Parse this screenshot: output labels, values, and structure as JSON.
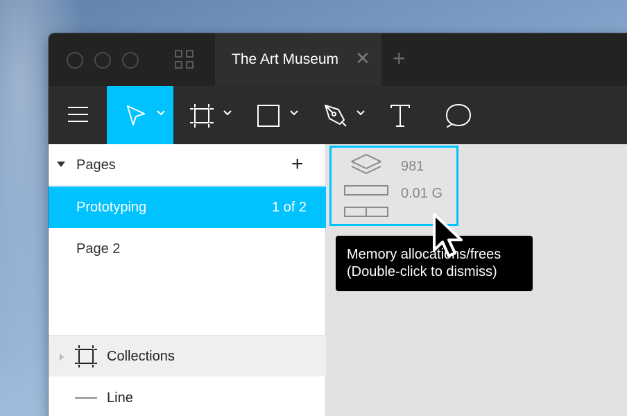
{
  "window": {
    "tab_title": "The Art Museum",
    "tab_close": "✕",
    "new_tab": "+"
  },
  "toolbar": {
    "tools": [
      {
        "name": "menu",
        "icon": "hamburger-menu-icon",
        "active": false
      },
      {
        "name": "select",
        "icon": "pointer-arrow-icon",
        "active": true
      },
      {
        "name": "frame",
        "icon": "frame-icon",
        "active": false
      },
      {
        "name": "shape",
        "icon": "rectangle-icon",
        "active": false
      },
      {
        "name": "pen",
        "icon": "pen-nib-icon",
        "active": false
      },
      {
        "name": "text",
        "icon": "text-t-icon",
        "active": false
      },
      {
        "name": "comment",
        "icon": "speech-bubble-icon",
        "active": false
      }
    ],
    "active_color": "#00c2ff"
  },
  "pages": {
    "title": "Pages",
    "add": "+",
    "items": [
      {
        "label": "Prototyping",
        "count": "1 of 2",
        "active": true
      },
      {
        "label": "Page 2",
        "count": "",
        "active": false
      }
    ]
  },
  "layers": [
    {
      "label": "Collections",
      "icon": "frame-icon",
      "selected": true
    },
    {
      "label": "Line",
      "icon": "line-icon",
      "selected": false
    }
  ],
  "stats": {
    "layers_count": "981",
    "memory": "0.01 G"
  },
  "tooltip": {
    "line1": "Memory allocations/frees",
    "line2": "(Double-click to dismiss)"
  }
}
